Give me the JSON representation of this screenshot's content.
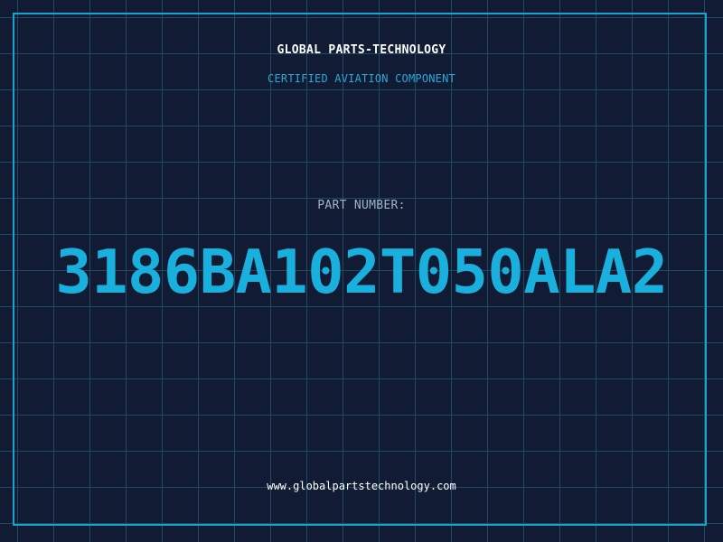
{
  "header": {
    "brand": "GLOBAL PARTS-TECHNOLOGY",
    "subtitle": "CERTIFIED AVIATION COMPONENT"
  },
  "part": {
    "label": "PART NUMBER:",
    "number": "3186BA102T050ALA2"
  },
  "footer": {
    "website": "www.globalpartstechnology.com"
  },
  "colors": {
    "background": "#111b33",
    "grid": "#1f4a63",
    "accent": "#1ab0de",
    "text": "#ffffff"
  }
}
